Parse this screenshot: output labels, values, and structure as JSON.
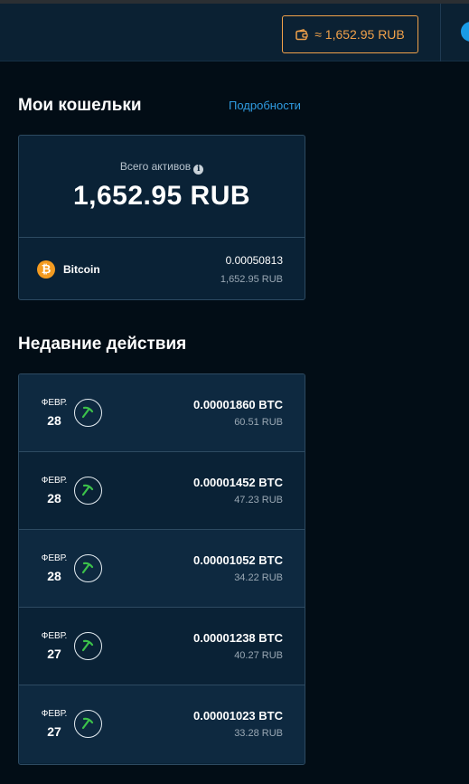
{
  "header": {
    "balance_label": "≈ 1,652.95 RUB"
  },
  "wallets": {
    "title": "Мои кошельки",
    "details_link": "Подробности",
    "total_label": "Всего активов",
    "total_value": "1,652.95 RUB",
    "coin": {
      "name": "Bitcoin",
      "symbol": "₿",
      "amount": "0.00050813",
      "fiat": "1,652.95 RUB"
    }
  },
  "activity": {
    "title": "Недавние действия",
    "items": [
      {
        "month": "ФЕВР.",
        "day": "28",
        "amount": "0.00001860 BTC",
        "fiat": "60.51 RUB"
      },
      {
        "month": "ФЕВР.",
        "day": "28",
        "amount": "0.00001452 BTC",
        "fiat": "47.23 RUB"
      },
      {
        "month": "ФЕВР.",
        "day": "28",
        "amount": "0.00001052 BTC",
        "fiat": "34.22 RUB"
      },
      {
        "month": "ФЕВР.",
        "day": "27",
        "amount": "0.00001238 BTC",
        "fiat": "40.27 RUB"
      },
      {
        "month": "ФЕВР.",
        "day": "27",
        "amount": "0.00001023 BTC",
        "fiat": "33.28 RUB"
      }
    ]
  },
  "icons": {
    "wallet": "wallet-icon",
    "info": "info-icon",
    "coin": "bitcoin-icon",
    "activity": "pickaxe-icon"
  },
  "colors": {
    "accent_orange": "#f0a14a",
    "link_blue": "#2f9be0",
    "bitcoin_orange": "#f39b21",
    "pickaxe_green": "#3cc24a"
  }
}
